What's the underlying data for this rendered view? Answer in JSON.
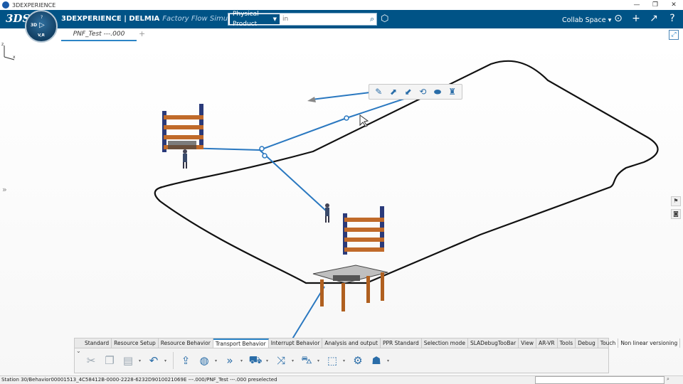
{
  "window": {
    "title": "3DEXPERIENCE",
    "minimize": "—",
    "restore": "❐",
    "close": "✕"
  },
  "topbar": {
    "logo": "3DS",
    "brand_bold": "3DEXPERIENCE | DELMIA",
    "app_name": "Factory Flow Simulation",
    "search_scope": "Physical Product",
    "search_placeholder": "in",
    "collab_space": "Collab Space",
    "accent": "#005386"
  },
  "compass": {
    "top": "?",
    "left": "3D",
    "bottom": "V,R"
  },
  "tabs": [
    {
      "label": "PNF_Test ---.000"
    }
  ],
  "tab_add": "+",
  "context_toolbar": [
    "pencil-icon",
    "move-icon",
    "place-icon",
    "rotate-icon",
    "surface-icon",
    "robot-icon"
  ],
  "action_bar": {
    "tabs": [
      "Standard",
      "Resource Setup",
      "Resource Behavior",
      "Transport Behavior",
      "Interrupt Behavior",
      "Analysis and output",
      "PPR Standard",
      "Selection mode",
      "SLADebugTooBar",
      "View",
      "AR-VR",
      "Tools",
      "Debug",
      "Touch",
      "Non linear versioning"
    ],
    "active_tab": "Transport Behavior"
  },
  "status": {
    "message": "Station 30/Behavior00001513_4C58412B-0000-2228-6232D9010021069E ---.000/PNF_Test ---.000 preselected"
  },
  "axes": {
    "z": "z",
    "x": "x"
  }
}
